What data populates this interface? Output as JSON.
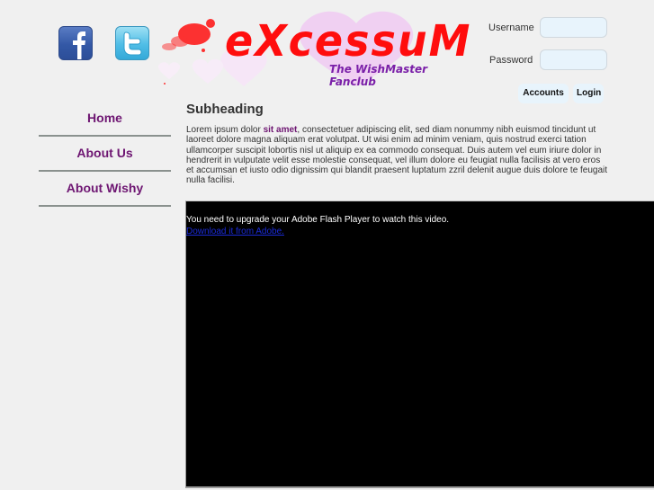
{
  "social": {
    "facebook_icon": "facebook-icon",
    "twitter_icon": "twitter-icon"
  },
  "logo": {
    "title": "eXcessuM",
    "subtitle": "The WishMaster Fanclub"
  },
  "login": {
    "username_label": "Username",
    "username_value": "",
    "password_label": "Password",
    "password_value": "",
    "accounts_button": "Accounts",
    "login_button": "Login"
  },
  "nav": {
    "items": [
      {
        "label": "Home"
      },
      {
        "label": "About Us"
      },
      {
        "label": "About Wishy"
      }
    ]
  },
  "content": {
    "subheading": "Subheading",
    "text_before_link": "Lorem ipsum dolor ",
    "link_text": "sit amet",
    "text_after_link": ", consectetuer adipiscing elit, sed diam nonummy nibh euismod tincidunt ut laoreet dolore magna aliquam erat volutpat. Ut wisi enim ad minim veniam, quis nostrud exerci tation ullamcorper suscipit lobortis nisl ut aliquip ex ea commodo consequat. Duis autem vel eum iriure dolor in hendrerit in vulputate velit esse molestie consequat, vel illum dolore eu feugiat nulla facilisis at vero eros et accumsan et iusto odio dignissim qui blandit praesent luptatum zzril delenit augue duis dolore te feugait nulla facilisi."
  },
  "video": {
    "message": "You need to upgrade your Adobe Flash Player to watch this video.",
    "download_link": "Download it from Adobe."
  },
  "colors": {
    "nav_text": "#6e1672",
    "logo_red": "#ff0d0d",
    "logo_purple": "#7a1fa8",
    "input_bg": "#e8f4fc"
  }
}
